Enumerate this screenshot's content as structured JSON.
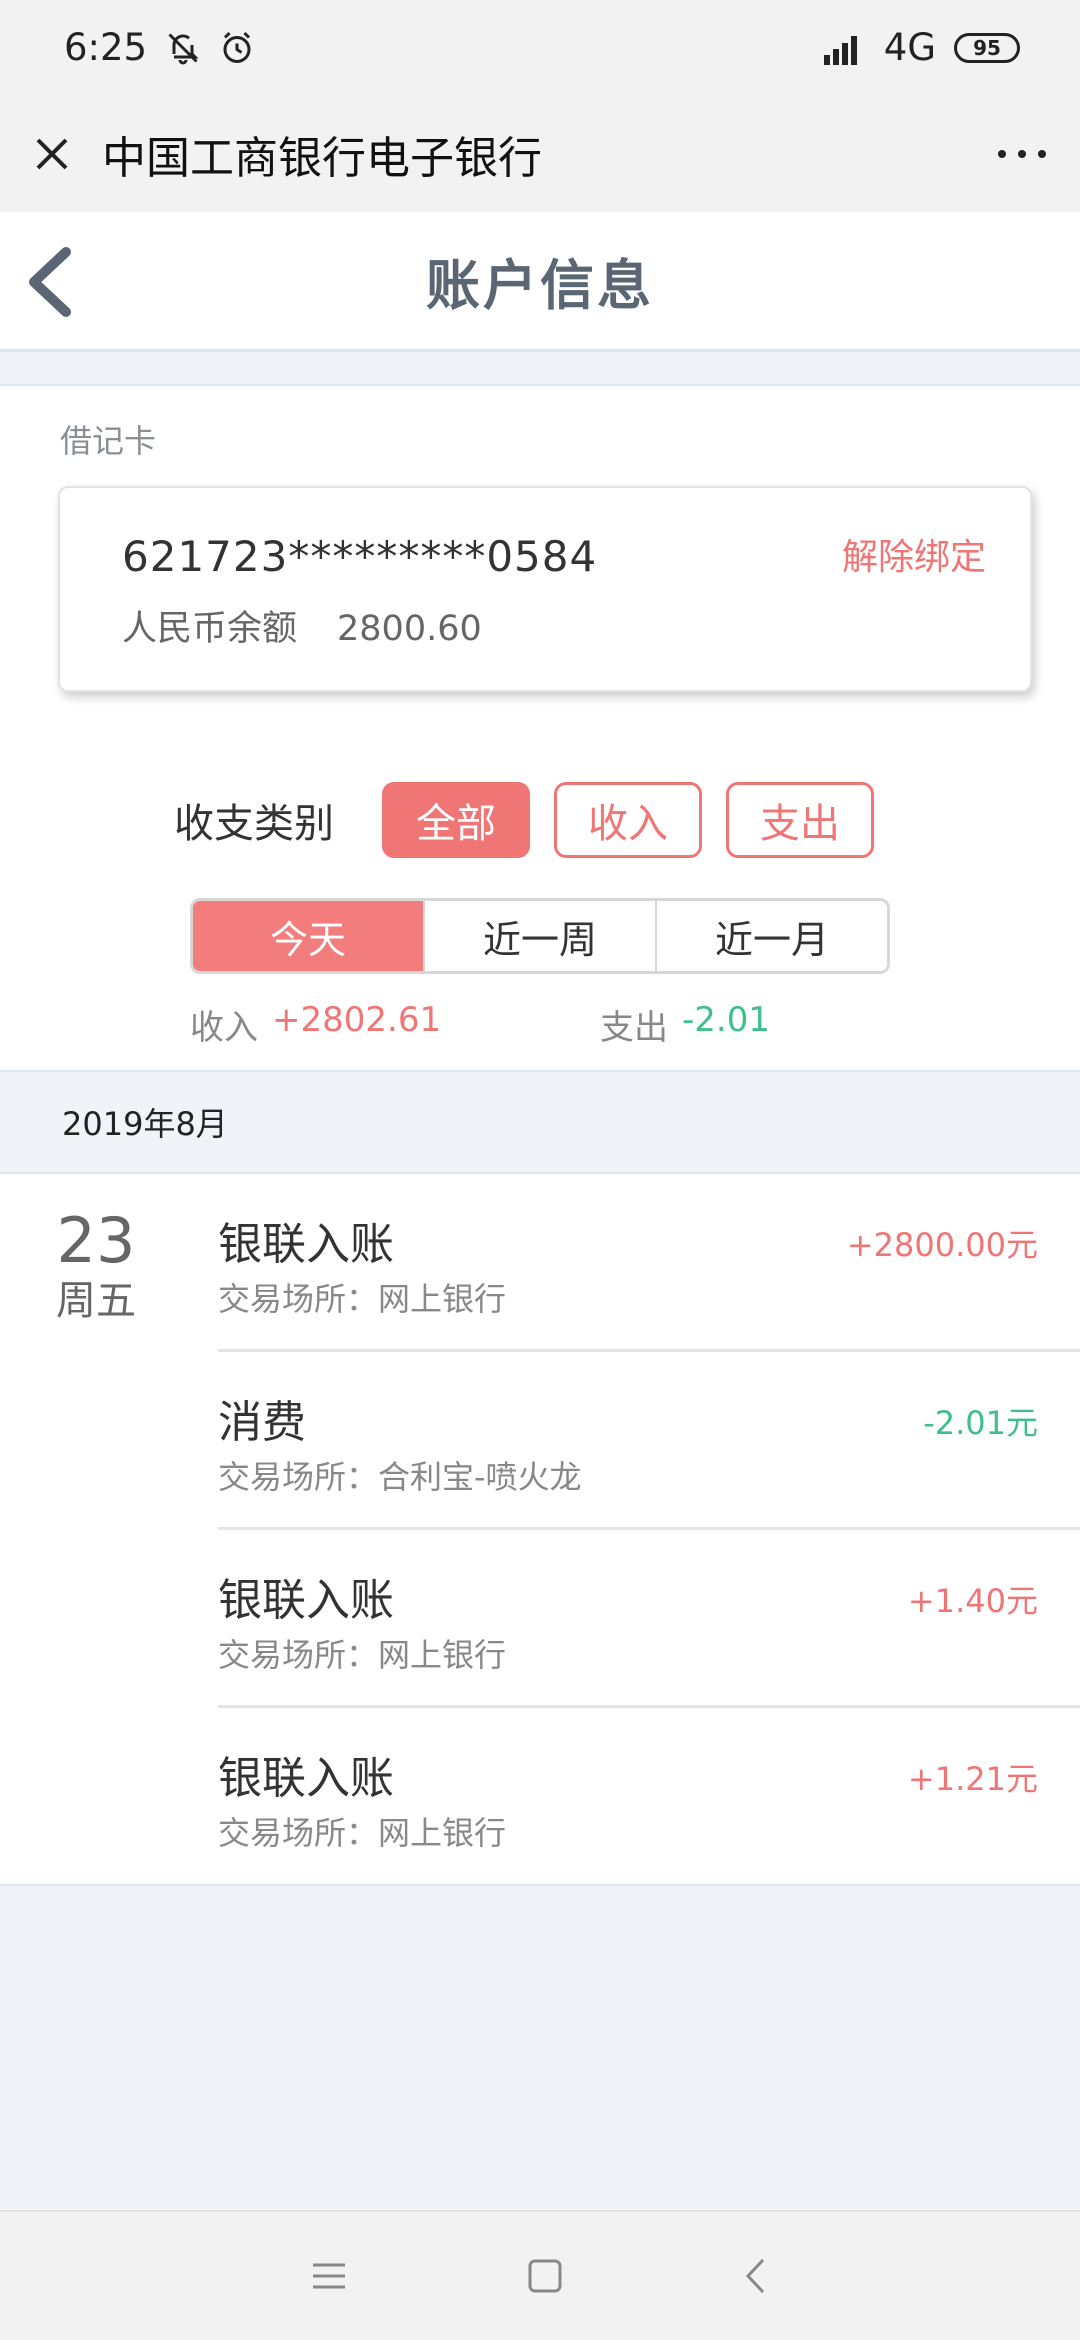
{
  "status_bar": {
    "time": "6:25",
    "network": "4G",
    "battery": "95"
  },
  "title_bar": {
    "title": "中国工商银行电子银行"
  },
  "nav": {
    "title": "账户信息"
  },
  "account": {
    "card_type": "借记卡",
    "card_number": "621723*********0584",
    "unbind_label": "解除绑定",
    "balance_label": "人民币余额",
    "balance_value": "2800.60"
  },
  "filters": {
    "label": "收支类别",
    "types": [
      "全部",
      "收入",
      "支出"
    ],
    "selected_type": "全部",
    "periods": [
      "今天",
      "近一周",
      "近一月"
    ],
    "selected_period": "今天"
  },
  "summary": {
    "income_label": "收入",
    "income_value": "+2802.61",
    "expense_label": "支出",
    "expense_value": "-2.01"
  },
  "month": "2019年8月",
  "day": {
    "date": "23",
    "weekday": "周五"
  },
  "transactions": [
    {
      "title": "银联入账",
      "place": "交易场所：网上银行",
      "amount": "+2800.00元"
    },
    {
      "title": "消费",
      "place": "交易场所：合利宝-喷火龙",
      "amount": "-2.01元"
    },
    {
      "title": "银联入账",
      "place": "交易场所：网上银行",
      "amount": "+1.40元"
    },
    {
      "title": "银联入账",
      "place": "交易场所：网上银行",
      "amount": "+1.21元"
    }
  ],
  "colors": {
    "accent": "#f07575",
    "income": "#f07575",
    "expense": "#3fbf8a"
  }
}
